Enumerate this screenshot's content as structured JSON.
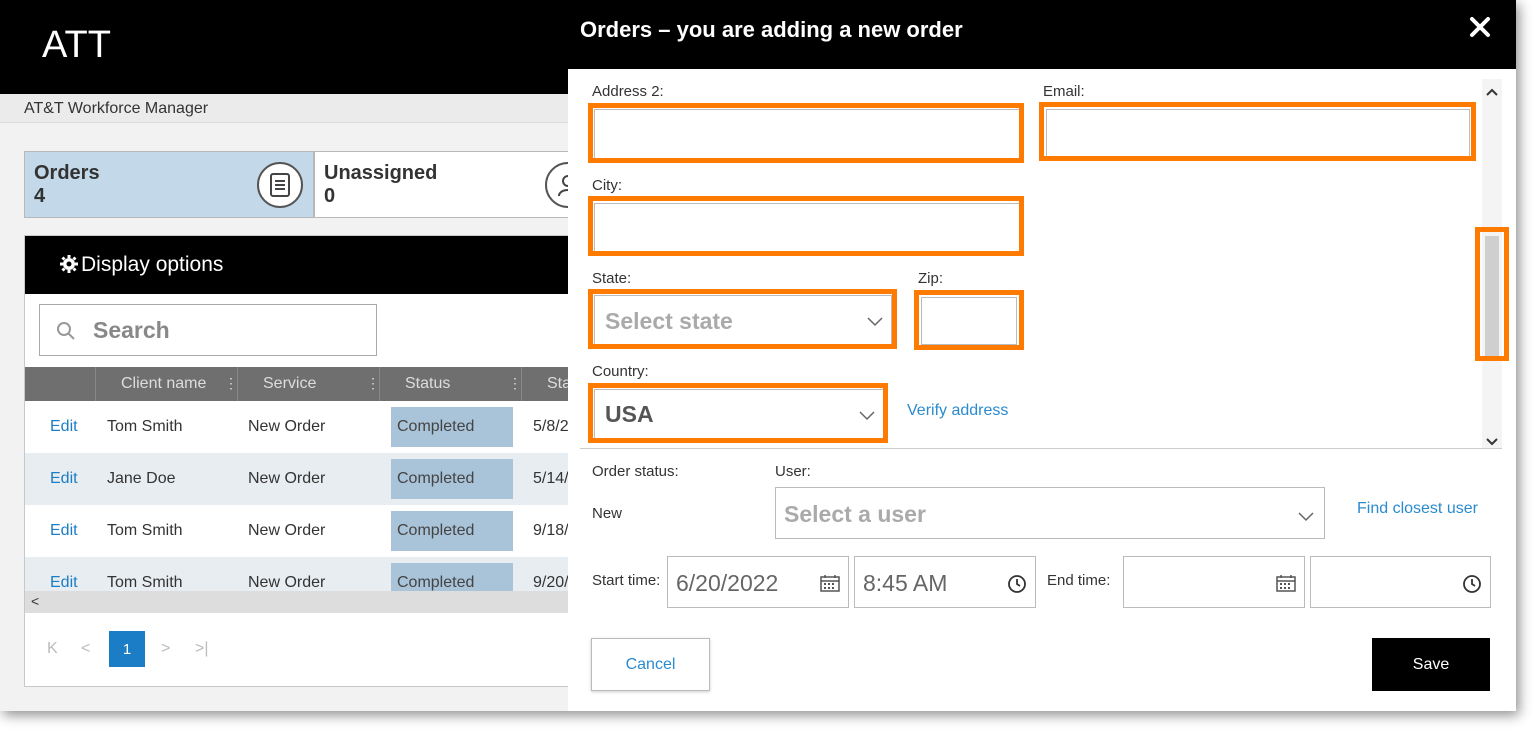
{
  "app": {
    "title": "ATT",
    "subtitle": "AT&T Workforce Manager"
  },
  "summary": {
    "orders": {
      "label": "Orders",
      "count": "4"
    },
    "unassigned": {
      "label": "Unassigned",
      "count": "0"
    }
  },
  "grid": {
    "display_options": "Display options",
    "search_placeholder": "Search",
    "columns": [
      "Client name",
      "Service",
      "Status",
      "Sta"
    ],
    "rows": [
      {
        "action": "Edit",
        "client": "Tom Smith",
        "service": "New Order",
        "status": "Completed",
        "start": "5/8/2"
      },
      {
        "action": "Edit",
        "client": "Jane Doe",
        "service": "New Order",
        "status": "Completed",
        "start": "5/14/"
      },
      {
        "action": "Edit",
        "client": "Tom Smith",
        "service": "New Order",
        "status": "Completed",
        "start": "9/18/"
      },
      {
        "action": "Edit",
        "client": "Tom Smith",
        "service": "New Order",
        "status": "Completed",
        "start": "9/20/"
      }
    ],
    "pager": {
      "first": "K",
      "prev": "<",
      "current": "1",
      "next": ">",
      "last": ">|"
    },
    "hscroll_left": "<"
  },
  "modal": {
    "title": "Orders – you are adding a new order",
    "close_icon": "close-icon",
    "fields": {
      "address2_label": "Address 2:",
      "email_label": "Email:",
      "city_label": "City:",
      "state_label": "State:",
      "state_value": "Select state",
      "zip_label": "Zip:",
      "country_label": "Country:",
      "country_value": "USA",
      "verify_address": "Verify address"
    },
    "order": {
      "status_label": "Order status:",
      "status_value": "New",
      "user_label": "User:",
      "user_placeholder": "Select a user",
      "find_closest": "Find closest user",
      "start_label": "Start time:",
      "start_date": "6/20/2022",
      "start_time": "8:45 AM",
      "end_label": "End time:",
      "end_date": "",
      "end_time": ""
    },
    "buttons": {
      "cancel": "Cancel",
      "save": "Save"
    },
    "highlight_color": "#ff7a00"
  }
}
